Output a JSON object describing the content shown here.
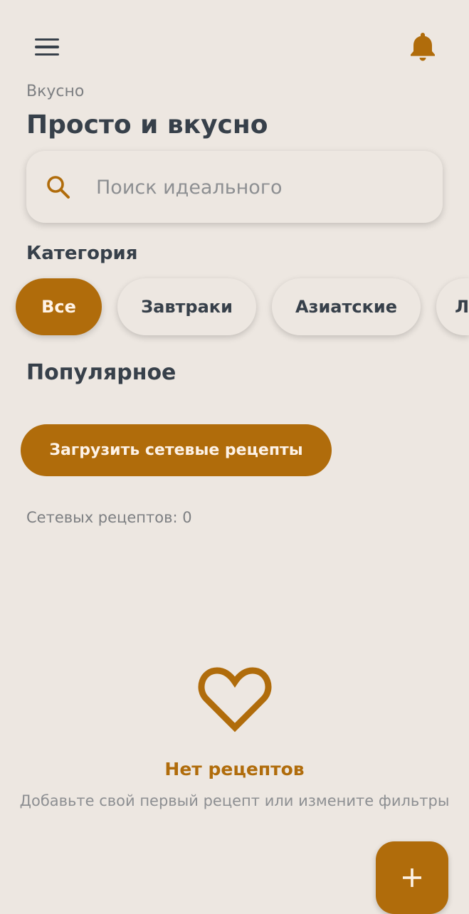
{
  "header": {
    "menu_icon": "hamburger-menu-icon",
    "notification_icon": "bell-icon",
    "subtitle": "Вкусно",
    "title": "Просто и вкусно"
  },
  "search": {
    "icon": "search-icon",
    "placeholder": "Поиск идеального",
    "value": ""
  },
  "categories": {
    "label": "Категория",
    "items": [
      {
        "label": "Все",
        "active": true
      },
      {
        "label": "Завтраки",
        "active": false
      },
      {
        "label": "Азиатские",
        "active": false
      },
      {
        "label": "Л",
        "active": false
      }
    ]
  },
  "popular": {
    "label": "Популярное",
    "load_button": "Загрузить сетевые рецепты",
    "count_text": "Сетевых рецептов: 0"
  },
  "empty_state": {
    "icon": "heart-outline-icon",
    "title": "Нет рецептов",
    "message": "Добавьте свой первый рецепт или измените фильтры"
  },
  "fab": {
    "icon": "plus-icon"
  },
  "colors": {
    "background": "#ede7e1",
    "accent": "#b06c0b",
    "text_primary": "#37404a",
    "text_secondary": "#7d7f82"
  }
}
